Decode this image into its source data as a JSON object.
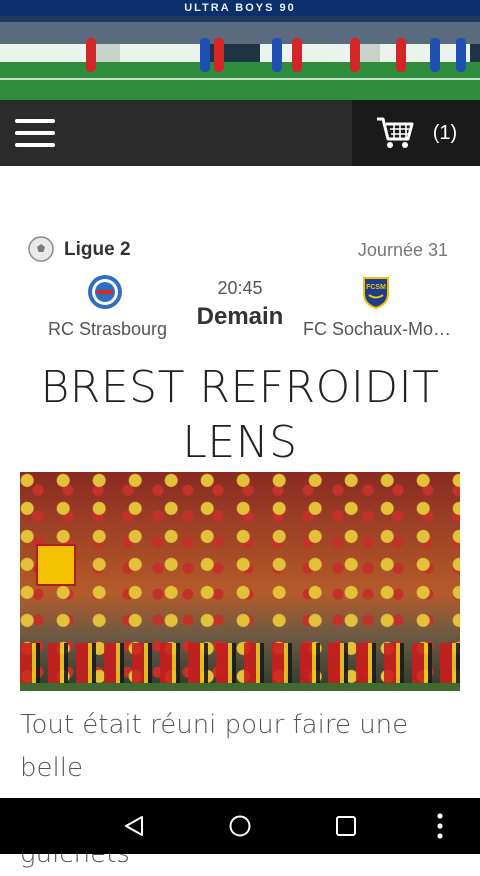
{
  "hero": {
    "banner_text": "ULTRA BOYS 90"
  },
  "appbar": {
    "cart_count": "(1)"
  },
  "match": {
    "league": "Ligue 2",
    "round": "Journée 31",
    "time": "20:45",
    "day": "Demain",
    "home_team": "RC Strasbourg",
    "away_team": "FC Sochaux-Mon...",
    "home_crest_text": "",
    "away_crest_text": "FCSM"
  },
  "article": {
    "title_line1": "BREST REFROIDIT",
    "title_line2": "LENS",
    "lead_line1": "Tout était réuni pour faire une belle",
    "lead_line2": "fête côté lensois : un stade à guichets"
  },
  "colors": {
    "appbar": "#2b2b2b",
    "cart_bg": "#1a1a1a",
    "navbar": "#000000"
  }
}
